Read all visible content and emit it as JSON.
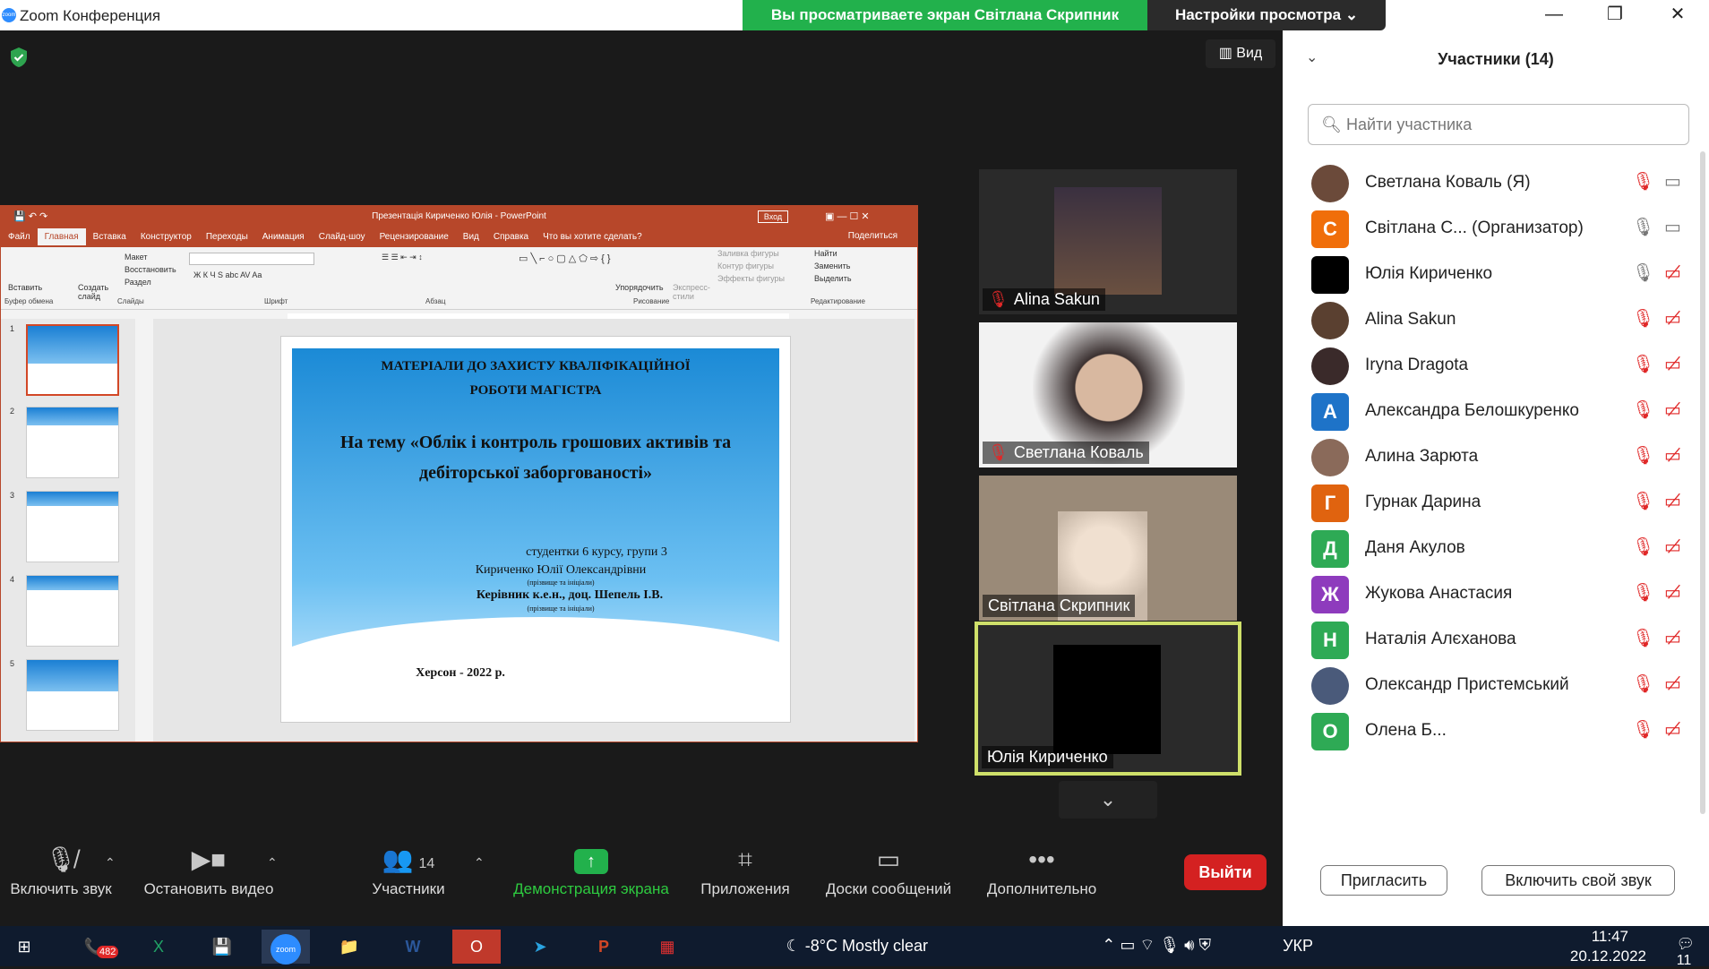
{
  "window": {
    "title": "Zoom Конференция",
    "app_icon": "zoom",
    "share_banner": "Вы просматриваете экран Світлана Скрипник",
    "view_settings": "Настройки просмотра ⌄"
  },
  "view_button": "Вид",
  "ppt": {
    "title": "Презентація Кириченко Юлія  -  PowerPoint",
    "login": "Вход",
    "tabs": [
      "Файл",
      "Главная",
      "Вставка",
      "Конструктор",
      "Переходы",
      "Анимация",
      "Слайд-шоу",
      "Рецензирование",
      "Вид",
      "Справка",
      "Что вы хотите сделать?"
    ],
    "share": "Поделиться",
    "groups": [
      "Буфер обмена",
      "Слайды",
      "Шрифт",
      "Абзац",
      "Рисование",
      "Редактирование"
    ],
    "ribbon_labels": [
      "Вставить",
      "Создать слайд",
      "Макет",
      "Восстановить",
      "Раздел",
      "Упорядочить",
      "Экспресс-стили",
      "Заливка фигуры",
      "Контур фигуры",
      "Эффекты фигуры",
      "Найти",
      "Заменить",
      "Выделить"
    ],
    "thumb_numbers": [
      "1",
      "2",
      "3",
      "4",
      "5"
    ]
  },
  "slide": {
    "line1": "МАТЕРІАЛИ ДО ЗАХИСТУ КВАЛІФІКАЦІЙНОЇ",
    "line2": "РОБОТИ МАГІСТРА",
    "topic1": "На тему «Облік і контроль грошових активів та",
    "topic2": "дебіторської заборгованості»",
    "student1": "студентки 6 курсу, групи 3",
    "student2": "Кириченко Юлії Олександрівни",
    "student_hint": "(прізвище та ініціали)",
    "supervisor": "Керівник к.е.н., доц. Шепель І.В.",
    "supervisor_hint": "(прізвище та ініціали)",
    "city": "Херсон -  2022 р."
  },
  "videos": [
    {
      "name": "Alina Sakun",
      "muted": true
    },
    {
      "name": "Светлана Коваль",
      "muted": true
    },
    {
      "name": "Світлана Скрипник",
      "muted": false
    },
    {
      "name": "Юлія Кириченко",
      "muted": false
    }
  ],
  "toolbar": {
    "mute": "Включить звук",
    "video": "Остановить видео",
    "participants": "Участники",
    "participants_count": "14",
    "share": "Демонстрация экрана",
    "apps": "Приложения",
    "boards": "Доски сообщений",
    "more": "Дополнительно",
    "leave": "Выйти"
  },
  "panel": {
    "title": "Участники (14)",
    "search_placeholder": "Найти участника",
    "invite": "Пригласить",
    "unmute": "Включить свой звук",
    "participants": [
      {
        "name": "Светлана Коваль (Я)",
        "avatar": "photo",
        "color": "#6b4a3a",
        "mic": "muted",
        "cam": "on"
      },
      {
        "name": "Світлана С...  (Организатор)",
        "avatar": "С",
        "color": "#f06e0a",
        "mic": "on",
        "cam": "on"
      },
      {
        "name": "Юлія Кириченко",
        "avatar": "",
        "color": "#000000",
        "mic": "on",
        "cam": "off"
      },
      {
        "name": "Alina Sakun",
        "avatar": "photo",
        "color": "#5a4030",
        "mic": "muted",
        "cam": "off"
      },
      {
        "name": "Iryna Dragota",
        "avatar": "photo",
        "color": "#3a2a2a",
        "mic": "muted",
        "cam": "off"
      },
      {
        "name": "Александра Белошкуренко",
        "avatar": "А",
        "color": "#1e73c8",
        "mic": "muted",
        "cam": "off"
      },
      {
        "name": "Алина Зарюта",
        "avatar": "photo",
        "color": "#8a6a5a",
        "mic": "muted",
        "cam": "off"
      },
      {
        "name": "Гурнак Дарина",
        "avatar": "Г",
        "color": "#e0630f",
        "mic": "muted",
        "cam": "off"
      },
      {
        "name": "Даня Акулов",
        "avatar": "Д",
        "color": "#2eaa55",
        "mic": "muted",
        "cam": "off"
      },
      {
        "name": "Жукова Анастасия",
        "avatar": "Ж",
        "color": "#8e3bbd",
        "mic": "muted",
        "cam": "off"
      },
      {
        "name": "Наталія Алєханова",
        "avatar": "Н",
        "color": "#2eaa55",
        "mic": "muted",
        "cam": "off"
      },
      {
        "name": "Олександр Пристемський",
        "avatar": "photo",
        "color": "#4a5a7a",
        "mic": "muted",
        "cam": "off"
      },
      {
        "name": "Олена Б...",
        "avatar": "О",
        "color": "#2eaa55",
        "mic": "muted",
        "cam": "off"
      }
    ]
  },
  "taskbar": {
    "viber_badge": "482",
    "weather": "-8°C  Mostly clear",
    "lang": "УКР",
    "time": "11:47",
    "date": "20.12.2022",
    "notif": "11"
  }
}
